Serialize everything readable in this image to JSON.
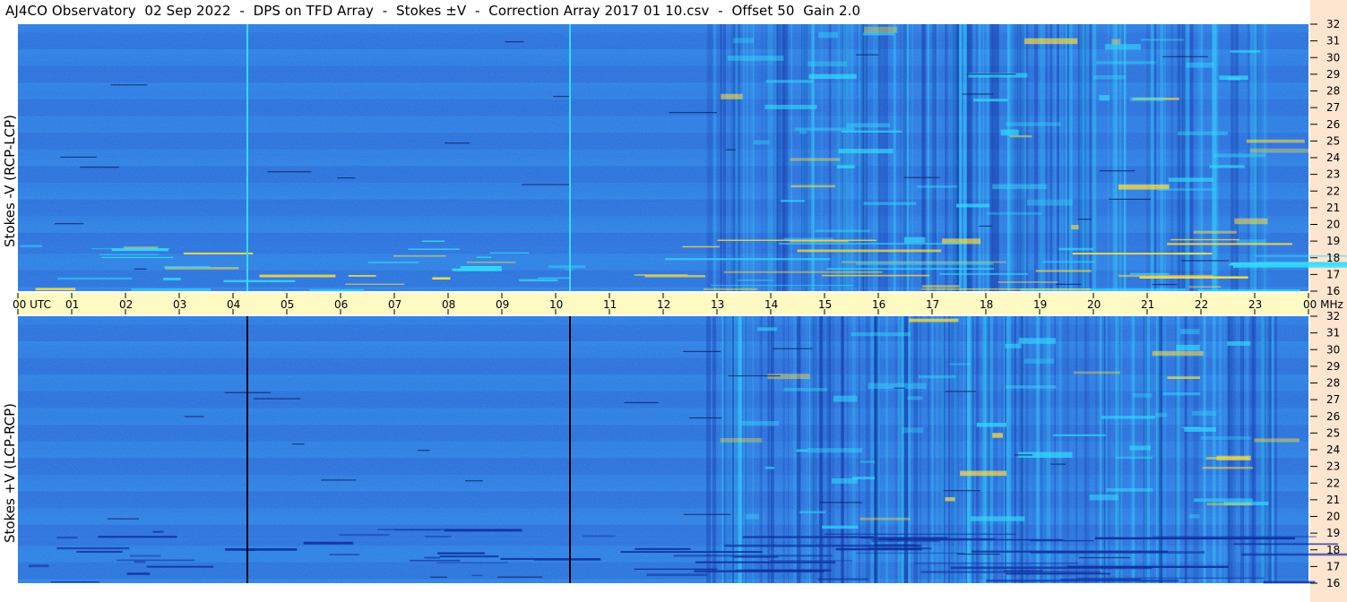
{
  "title": "AJ4CO Observatory  02 Sep 2022  -  DPS on TFD Array  -  Stokes ±V  -  Correction Array 2017 01 10.csv  -  Offset 50  Gain 2.0",
  "chart_data": [
    {
      "type": "heatmap",
      "panel": "top",
      "ylabel": "Stokes -V (RCP-LCP)",
      "x_ticks": [
        "00 UTC",
        "01",
        "02",
        "03",
        "04",
        "05",
        "06",
        "07",
        "08",
        "09",
        "10",
        "11",
        "12",
        "13",
        "14",
        "15",
        "16",
        "17",
        "18",
        "19",
        "20",
        "21",
        "22",
        "23",
        "00 MHz"
      ],
      "y_ticks": [
        "32",
        "31",
        "30",
        "29",
        "28",
        "27",
        "26",
        "25",
        "24",
        "23",
        "22",
        "21",
        "20",
        "19",
        "18",
        "17",
        "16"
      ],
      "xlim": [
        0,
        24
      ],
      "ylim": [
        16,
        32
      ],
      "x_unit": "UTC hours",
      "y_unit": "MHz",
      "colors": {
        "base": "#2a74e0",
        "dark": "#1130a0",
        "bright": "#33ddff",
        "hot": "#ffe040"
      },
      "vertical_lines": [
        {
          "x": 4.25,
          "color": "#33ddff"
        },
        {
          "x": 10.25,
          "color": "#33ddff"
        }
      ]
    },
    {
      "type": "heatmap",
      "panel": "bottom",
      "ylabel": "Stokes +V (LCP-RCP)",
      "x_ticks": [
        "00 UTC",
        "01",
        "02",
        "03",
        "04",
        "05",
        "06",
        "07",
        "08",
        "09",
        "10",
        "11",
        "12",
        "13",
        "14",
        "15",
        "16",
        "17",
        "18",
        "19",
        "20",
        "21",
        "22",
        "23",
        "00 MHz"
      ],
      "y_ticks": [
        "32",
        "31",
        "30",
        "29",
        "28",
        "27",
        "26",
        "25",
        "24",
        "23",
        "22",
        "21",
        "20",
        "19",
        "18",
        "17",
        "16"
      ],
      "xlim": [
        0,
        24
      ],
      "ylim": [
        16,
        32
      ],
      "x_unit": "UTC hours",
      "y_unit": "MHz",
      "colors": {
        "base": "#2a74e0",
        "dark": "#1130a0",
        "bright": "#33ddff",
        "hot": "#ffe040"
      },
      "vertical_lines": [
        {
          "x": 4.25,
          "color": "#000000"
        },
        {
          "x": 10.25,
          "color": "#000000"
        }
      ]
    }
  ]
}
